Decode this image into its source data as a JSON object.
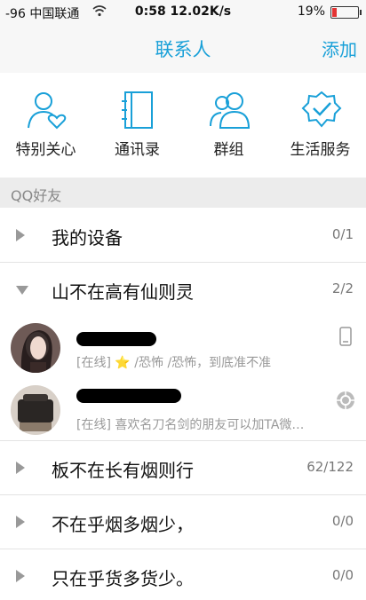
{
  "status_bar": {
    "carrier": "-96 中国联通",
    "time": "0:58 12.02K/s",
    "battery": "19%",
    "battery_level": 0.19
  },
  "nav": {
    "title": "联系人",
    "add_label": "添加"
  },
  "shortcuts": [
    {
      "label": "特别关心",
      "icon": "special-care-icon"
    },
    {
      "label": "通讯录",
      "icon": "address-book-icon"
    },
    {
      "label": "群组",
      "icon": "group-icon"
    },
    {
      "label": "生活服务",
      "icon": "life-service-icon"
    }
  ],
  "section": {
    "label": "QQ好友"
  },
  "groups": [
    {
      "name": "我的设备",
      "count": "0/1",
      "expanded": false
    },
    {
      "name": "山不在高有仙则灵",
      "count": "2/2",
      "expanded": true
    },
    {
      "name": "板不在长有烟则行",
      "count": "62/122",
      "expanded": false
    },
    {
      "name": "不在乎烟多烟少，",
      "count": "0/0",
      "expanded": false
    },
    {
      "name": "只在乎货多货少。",
      "count": "0/0",
      "expanded": false
    }
  ],
  "friends": [
    {
      "status_prefix": "[在线]",
      "star": "⭐",
      "status_text": "/恐怖 /恐怖，到底准不准",
      "device_icon": "phone-icon"
    },
    {
      "status_prefix": "[在线]",
      "star": "",
      "status_text": "喜欢名刀名剑的朋友可以加TA微…",
      "device_icon": "web-client-icon"
    }
  ],
  "colors": {
    "accent": "#19a0d8",
    "star": "#f5b800",
    "battery_low": "#e33333"
  }
}
